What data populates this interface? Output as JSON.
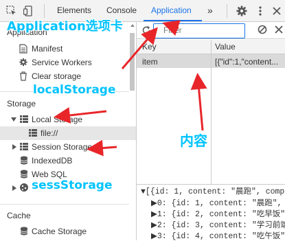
{
  "toolbar": {
    "tabs": [
      "Elements",
      "Console",
      "Application"
    ],
    "more": "»",
    "active_tab": "Application"
  },
  "sidebar": {
    "application_section": "Application",
    "items": [
      "Manifest",
      "Service Workers",
      "Clear storage"
    ],
    "storage_section": "Storage",
    "local_storage": "Local Storage",
    "local_storage_child": "file://",
    "session_storage": "Session Storage",
    "indexeddb": "IndexedDB",
    "websql": "Web SQL",
    "cache_section": "Cache",
    "cache_storage": "Cache Storage"
  },
  "filter": {
    "placeholder": "Filter"
  },
  "table": {
    "headers": [
      "Key",
      "Value"
    ],
    "rows": [
      {
        "key": "item",
        "value": "[{\"id\":1,\"content..."
      }
    ]
  },
  "preview": {
    "lines": [
      "▼[{id: 1, content: \"晨跑\", comp",
      "▶0: {id: 1, content: \"晨跑\",",
      "▶1: {id: 2, content: \"吃早饭\"",
      "▶2: {id: 3, content: \"学习前端",
      "▶3: {id: 4, content: \"吃午饭\""
    ]
  },
  "annotations": {
    "application_tab": "Application选项卡",
    "local_storage": "localStorage",
    "content": "内容",
    "session_storage": "sessStorage"
  },
  "colors": {
    "accent": "#1a73e8",
    "annotation": "#00c3ff",
    "arrow": "#e8262a"
  }
}
